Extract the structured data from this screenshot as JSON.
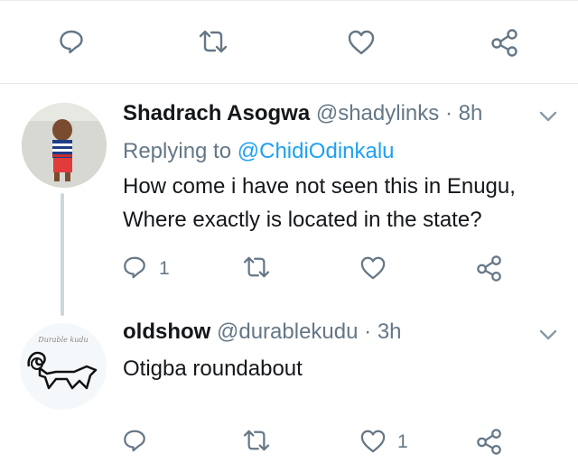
{
  "top_actions": {
    "icons": [
      "reply-icon",
      "retweet-icon",
      "like-icon",
      "share-icon"
    ]
  },
  "tweets": [
    {
      "display_name": "Shadrach Asogwa",
      "handle": "@shadylinks",
      "separator": "·",
      "time": "8h",
      "replying_label": "Replying to",
      "replying_to": "@ChidiOdinkalu",
      "text_line1": "How come i have not seen this in Enugu,",
      "text_line2": "Where exactly is located in the state?",
      "reply_count": "1",
      "like_count": ""
    },
    {
      "display_name": "oldshow",
      "handle": "@durablekudu",
      "separator": "·",
      "time": "3h",
      "avatar_caption": "Durable kudu",
      "text_line1": "Otigba roundabout",
      "reply_count": "",
      "like_count": "1"
    }
  ],
  "colors": {
    "text": "#14171a",
    "muted": "#657786",
    "link": "#1da1f2",
    "divider": "#e1e8ed"
  }
}
